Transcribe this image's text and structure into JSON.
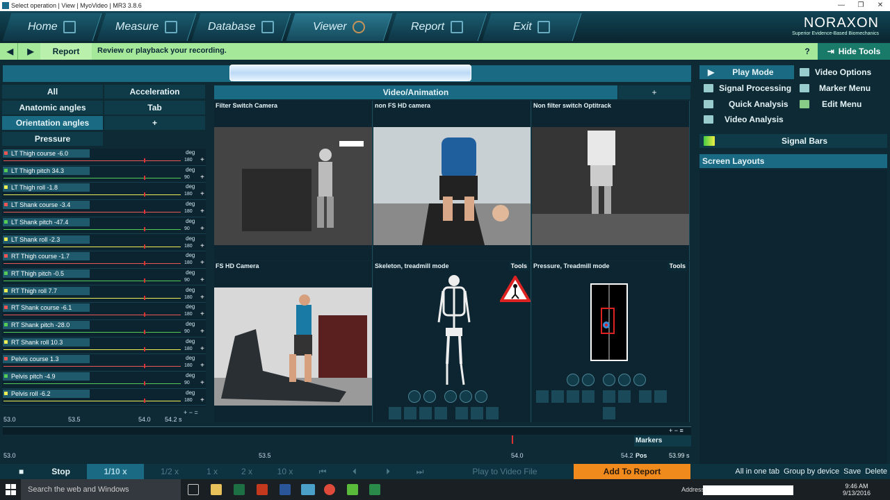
{
  "window": {
    "title": "Select operation | View | MyoVideo | MR3 3.8.6",
    "controls": [
      "—",
      "❐",
      "✕"
    ]
  },
  "nav": {
    "tabs": [
      "Home",
      "Measure",
      "Database",
      "Viewer",
      "Report",
      "Exit"
    ]
  },
  "logo": {
    "name": "NORAXON",
    "tagline": "Superior Evidence-Based Biomechanics"
  },
  "toolbar": {
    "report_label": "Report",
    "message": "Review or playback your recording.",
    "help": "?",
    "hide_tools": "Hide Tools"
  },
  "left_tabs": {
    "all": "All",
    "acceleration": "Acceleration",
    "anatomic": "Anatomic angles",
    "tab": "Tab",
    "orientation": "Orientation angles",
    "plus": "+",
    "pressure": "Pressure"
  },
  "channels": [
    {
      "label": "LT Thigh course  -6.0",
      "unit": "deg",
      "limit": "180",
      "color": "#e55"
    },
    {
      "label": "LT Thigh pitch  34.3",
      "unit": "deg",
      "limit": "90",
      "color": "#5c5"
    },
    {
      "label": "LT Thigh roll  -1.8",
      "unit": "deg",
      "limit": "180",
      "color": "#ee5"
    },
    {
      "label": "LT Shank course  -3.4",
      "unit": "deg",
      "limit": "180",
      "color": "#e55"
    },
    {
      "label": "LT Shank pitch  -47.4",
      "unit": "deg",
      "limit": "90",
      "color": "#5c5"
    },
    {
      "label": "LT Shank roll  -2.3",
      "unit": "deg",
      "limit": "180",
      "color": "#ee5"
    },
    {
      "label": "RT Thigh course  -1.7",
      "unit": "deg",
      "limit": "180",
      "color": "#e55"
    },
    {
      "label": "RT Thigh pitch  -0.5",
      "unit": "deg",
      "limit": "90",
      "color": "#5c5"
    },
    {
      "label": "RT Thigh roll  7.7",
      "unit": "deg",
      "limit": "180",
      "color": "#ee5"
    },
    {
      "label": "RT Shank course  -6.1",
      "unit": "deg",
      "limit": "180",
      "color": "#e55"
    },
    {
      "label": "RT Shank pitch  -28.0",
      "unit": "deg",
      "limit": "90",
      "color": "#5c5"
    },
    {
      "label": "RT Shank roll  10.3",
      "unit": "deg",
      "limit": "180",
      "color": "#ee5"
    },
    {
      "label": "Pelvis course  1.3",
      "unit": "deg",
      "limit": "180",
      "color": "#e55"
    },
    {
      "label": "Pelvis pitch  -4.9",
      "unit": "deg",
      "limit": "90",
      "color": "#5c5"
    },
    {
      "label": "Pelvis roll  -6.2",
      "unit": "deg",
      "limit": "180",
      "color": "#ee5"
    }
  ],
  "left_axis": {
    "t0": "53.0",
    "t1": "53.5",
    "t2": "54.0",
    "t3": "54.2 s",
    "ctrls": "+ − ="
  },
  "video": {
    "header": "Video/Animation",
    "plus": "+",
    "cells": [
      "Filter Switch Camera",
      "non FS HD camera",
      "Non filter switch Optitrack",
      "FS HD Camera",
      "Skeleton, treadmill mode",
      "Pressure, Treadmill mode"
    ],
    "tools": "Tools"
  },
  "right": {
    "play_mode": "Play Mode",
    "video_options": "Video Options",
    "signal_processing": "Signal Processing",
    "marker_menu": "Marker Menu",
    "quick_analysis": "Quick Analysis",
    "edit_menu": "Edit Menu",
    "video_analysis": "Video Analysis",
    "signal_bars": "Signal Bars",
    "screen_layouts": "Screen Layouts",
    "footer": [
      "All in one tab",
      "Group by device",
      "Save",
      "Delete"
    ]
  },
  "timeline": {
    "t0": "53.0",
    "t1": "53.5",
    "t2": "54.0",
    "t3": "54.2",
    "markers": "Markers",
    "pos_label": "Pos",
    "pos_value": "53.99 s"
  },
  "playback": {
    "stop": "Stop",
    "speeds": [
      "1/10 x",
      "1/2 x",
      "1 x",
      "2 x",
      "10 x"
    ],
    "play_video": "Play to Video File",
    "add_report": "Add To Report"
  },
  "taskbar": {
    "search": "Search the web and Windows",
    "address": "Address",
    "time": "9:46 AM",
    "date": "9/13/2016"
  }
}
